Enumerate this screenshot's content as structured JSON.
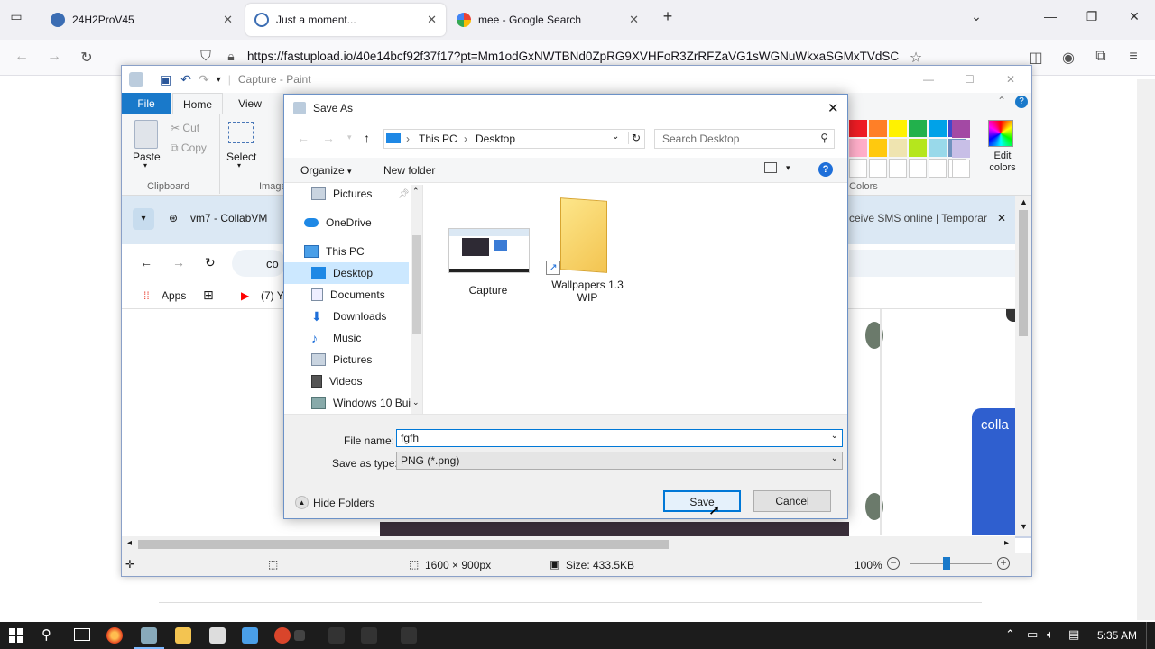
{
  "browser": {
    "tabs": [
      {
        "label": "24H2ProV45",
        "active": false
      },
      {
        "label": "Just a moment...",
        "active": true
      },
      {
        "label": "mee - Google Search",
        "active": false
      }
    ],
    "url": "https://fastupload.io/40e14bcf92f37f17?pt=Mm1odGxNWTBNd0ZpRG9XVHFoR3ZrRFZaVG1sWGNuWkxaSGMxTVdSC"
  },
  "paint": {
    "title": "Capture - Paint",
    "tabs": [
      "File",
      "Home",
      "View"
    ],
    "clipboard": {
      "paste": "Paste",
      "cut": "Cut",
      "copy": "Copy",
      "group": "Clipboard"
    },
    "image": {
      "select": "Select",
      "group": "Image"
    },
    "colors": {
      "edit": "Edit colors",
      "group": "Colors"
    },
    "inner": {
      "tab_title": "vm7 - CollabVM",
      "tab_right": "ceive SMS online | Temporar",
      "address_fragment": "co",
      "bookmark_apps": "Apps",
      "bookmark_yt": "(7) Y",
      "logo_text": "colla"
    },
    "status": {
      "dimensions": "1600 × 900px",
      "size": "Size: 433.5KB",
      "zoom": "100%"
    }
  },
  "dialog": {
    "title": "Save As",
    "breadcrumb": [
      "This PC",
      "Desktop"
    ],
    "search_placeholder": "Search Desktop",
    "organize": "Organize",
    "new_folder": "New folder",
    "nav": [
      {
        "label": "Pictures",
        "pinned": true
      },
      {
        "label": "OneDrive"
      },
      {
        "label": "This PC"
      },
      {
        "label": "Desktop",
        "selected": true
      },
      {
        "label": "Documents"
      },
      {
        "label": "Downloads"
      },
      {
        "label": "Music"
      },
      {
        "label": "Pictures"
      },
      {
        "label": "Videos"
      },
      {
        "label": "Windows 10 Buil"
      }
    ],
    "files": [
      {
        "name": "Capture"
      },
      {
        "name": "Wallpapers 1.3 WIP"
      }
    ],
    "file_name_label": "File name:",
    "file_name_value": "fgfh",
    "save_type_label": "Save as type:",
    "save_type_value": "PNG (*.png)",
    "hide_folders": "Hide Folders",
    "save": "Save",
    "cancel": "Cancel"
  },
  "taskbar": {
    "time": "5:35 AM"
  }
}
